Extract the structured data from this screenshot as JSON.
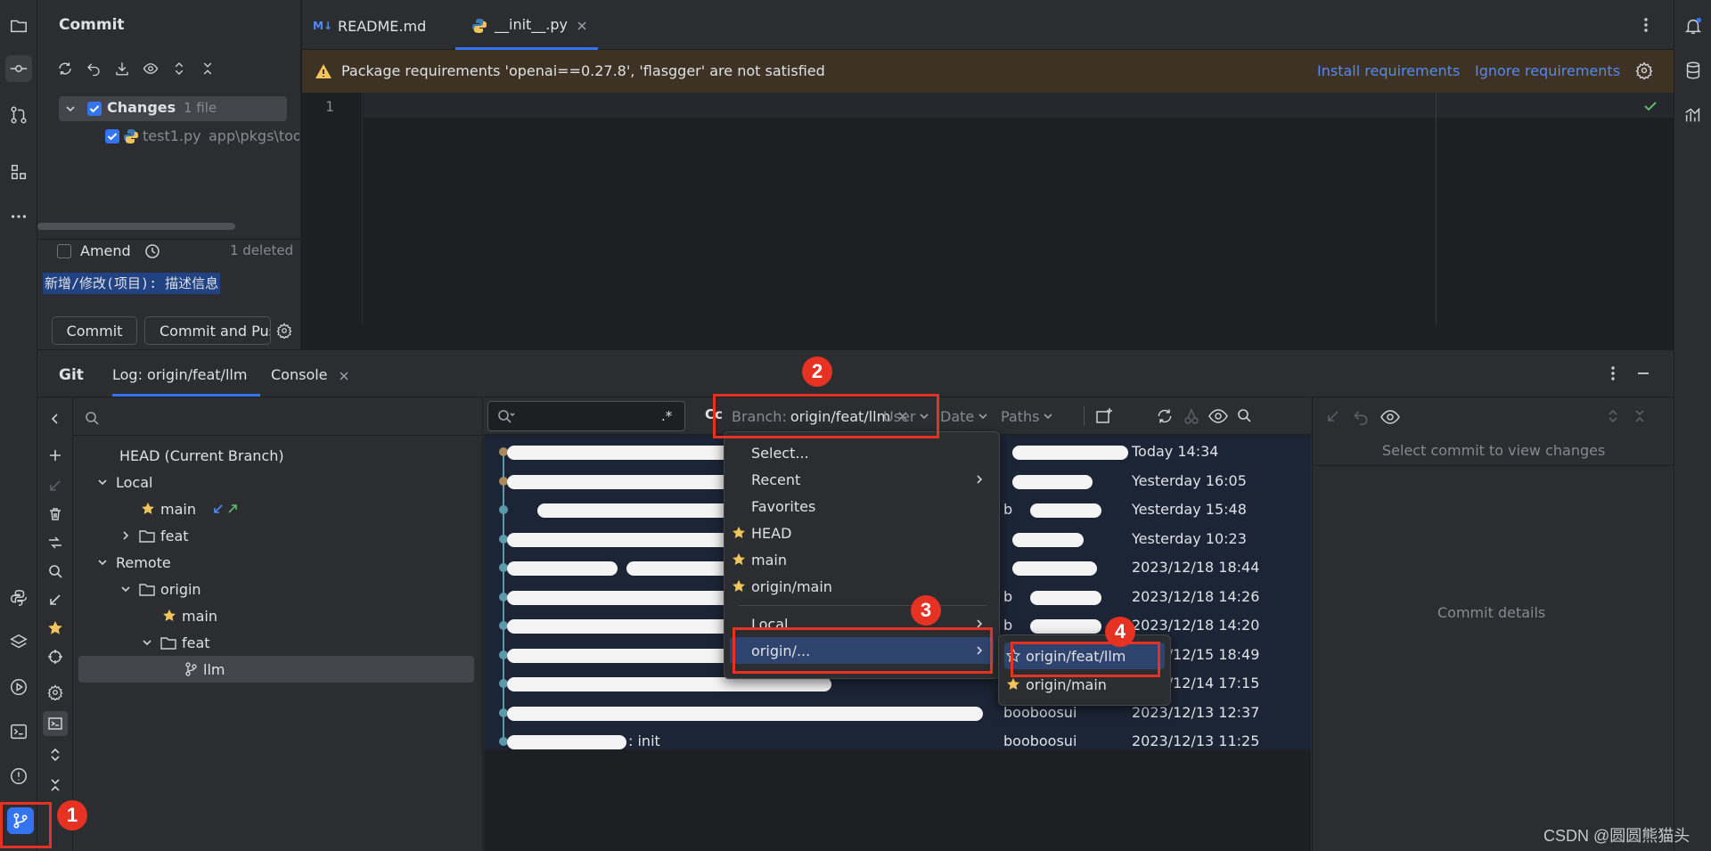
{
  "commit_panel": {
    "title": "Commit",
    "changes_label": "Changes",
    "changes_count": "1 file",
    "file_name": "test1.py",
    "file_path": "app\\pkgs\\too",
    "amend_label": "Amend",
    "deleted_label": "1 deleted",
    "message": "新增/修改(项目): 描述信息",
    "commit_button": "Commit",
    "commit_push_button": "Commit and Pus"
  },
  "editor": {
    "tabs": [
      {
        "label": "README.md",
        "badge": "M↓"
      },
      {
        "label": "__init__.py"
      }
    ],
    "warning_text": "Package requirements 'openai==0.27.8', 'flasgger' are not satisfied",
    "install_link": "Install requirements",
    "ignore_link": "Ignore requirements",
    "line_number": "1"
  },
  "git": {
    "title": "Git",
    "tabs": [
      {
        "label": "Log: origin/feat/llm"
      },
      {
        "label": "Console"
      }
    ],
    "branch_tree": {
      "head": "HEAD (Current Branch)",
      "local": "Local",
      "local_main": "main",
      "local_feat": "feat",
      "remote": "Remote",
      "origin": "origin",
      "origin_main": "main",
      "origin_feat": "feat",
      "llm": "llm"
    },
    "filter": {
      "regex": ".*",
      "case": "Cc",
      "branch_prefix": "Branch:",
      "branch_value": "origin/feat/llm",
      "user": "User",
      "date": "Date",
      "paths": "Paths"
    },
    "log_rows": [
      {
        "author": "",
        "date": "Today 14:34"
      },
      {
        "author": "",
        "date": "Yesterday 16:05"
      },
      {
        "author": "b",
        "date": "Yesterday 15:48"
      },
      {
        "author": "",
        "date": "Yesterday 10:23"
      },
      {
        "author": "",
        "date": "2023/12/18 18:44"
      },
      {
        "author": "b",
        "date": "2023/12/18 14:26"
      },
      {
        "author": "b",
        "date": "2023/12/18 14:20"
      },
      {
        "author": "",
        "date": "2023/12/15 18:49"
      },
      {
        "author": "",
        "date": "2023/12/14 17:15"
      },
      {
        "author": "booboosui",
        "date": "2023/12/13 12:37"
      },
      {
        "author": "booboosui",
        "date": "2023/12/13 11:25",
        "message_tail": ": init"
      }
    ],
    "details": {
      "select_commit": "Select commit to view changes",
      "commit_details": "Commit details"
    }
  },
  "branch_menu": {
    "items": [
      "Select...",
      "Recent",
      "Favorites",
      "HEAD",
      "main",
      "origin/main",
      "Local",
      "origin/..."
    ]
  },
  "submenu": {
    "items": [
      "origin/feat/llm",
      "origin/main"
    ]
  },
  "badges": [
    "1",
    "2",
    "3",
    "4"
  ],
  "watermark": "CSDN @圆圆熊猫头",
  "colors": {
    "accent": "#3574f0",
    "annotation_red": "#e53222",
    "star": "#f2c55c",
    "warning_bg": "#3d3223"
  }
}
